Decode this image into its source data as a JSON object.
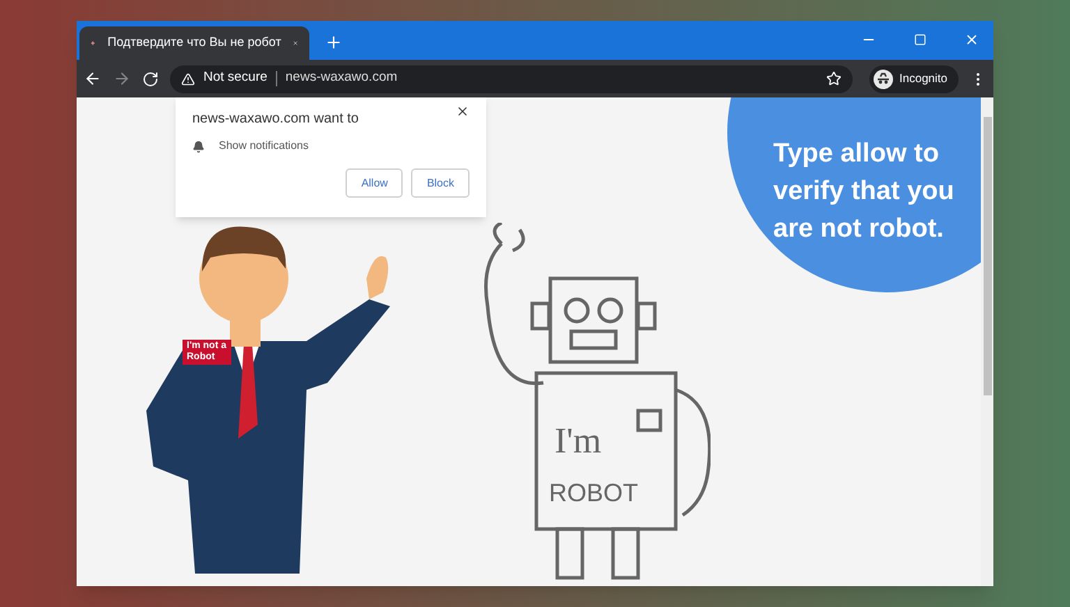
{
  "tab": {
    "title": "Подтвердите что Вы не робот",
    "selected": true
  },
  "toolbar": {
    "security": "Not secure",
    "url": "news-waxawo.com",
    "profile": "Incognito"
  },
  "popup": {
    "title": "news-waxawo.com want to",
    "permission": "Show notifications",
    "buttons": [
      "Allow",
      "Block"
    ]
  },
  "page": {
    "headline": "Type allow to\nverify that you\nare not robot.",
    "badge": [
      "I'm not a",
      "Robot"
    ],
    "robot_text": [
      "I'm",
      "ROBOT"
    ]
  }
}
